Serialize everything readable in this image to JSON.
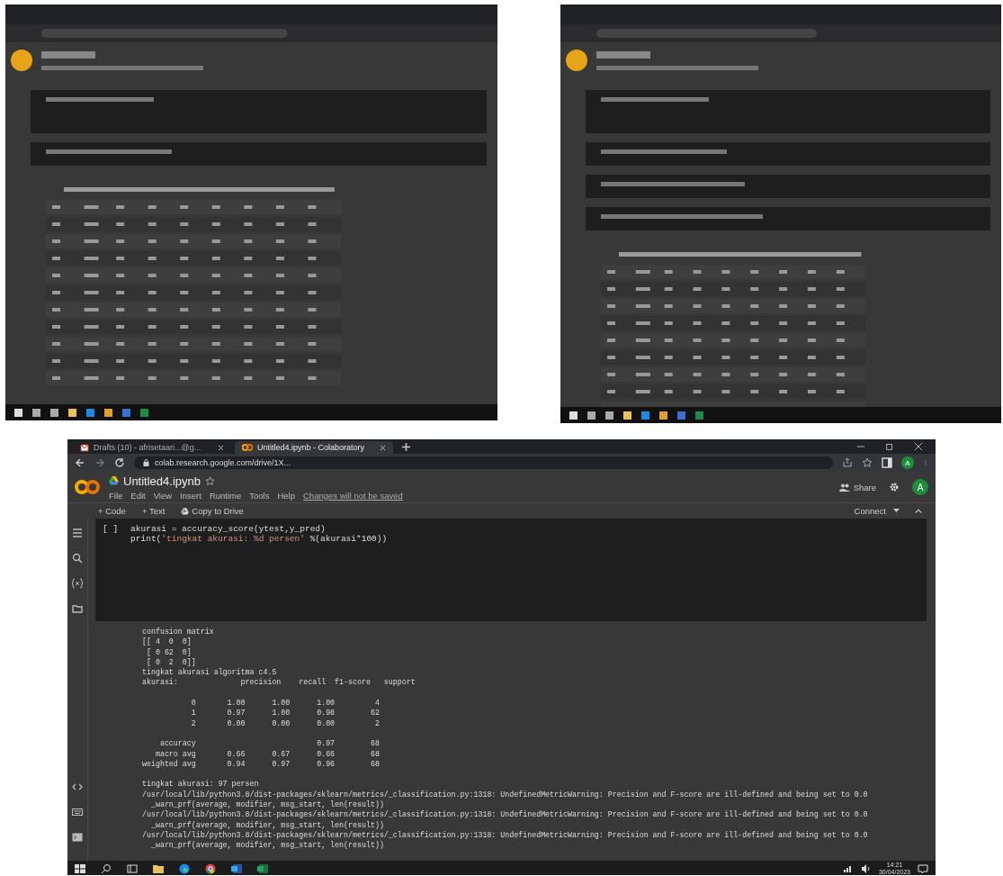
{
  "browser_tabs": [
    {
      "label": "Drafts (10) - afrisetaari...@g...",
      "kind": "mail",
      "selected": false
    },
    {
      "label": "Untitled4.ipynb - Colaboratory",
      "kind": "colab",
      "selected": true
    }
  ],
  "address_bar": {
    "url": "colab.research.google.com/drive/1X...",
    "avatar": "A"
  },
  "notebook": {
    "title": "Untitled4.ipynb",
    "menu": [
      "File",
      "Edit",
      "View",
      "Insert",
      "Runtime",
      "Tools",
      "Help"
    ],
    "notice": "Changes will not be saved",
    "share": "Share",
    "avatar": "A"
  },
  "toolbar": {
    "buttons": [
      "+ Code",
      "+ Text",
      "Copy to Drive"
    ],
    "connect": "Connect"
  },
  "code_cell": {
    "prompt": "[ ]",
    "lines": [
      [
        {
          "text": "akurasi = accuracy_score(ytest,y_pred)",
          "kind": "plain"
        }
      ],
      [
        {
          "text": "print(",
          "kind": "plain"
        },
        {
          "text": "'tingkat akurasi: %d persen'",
          "kind": "string"
        },
        {
          "text": " %(akurasi*100))",
          "kind": "plain"
        }
      ]
    ]
  },
  "output": {
    "blocks": [
      [
        "confusion matrix",
        "[[ 4  0  0]",
        " [ 0 62  0]",
        " [ 0  2  0]]",
        "tingkat akurasi algoritma c4.5",
        "akurasi:              precision    recall  f1-score   support"
      ],
      [
        "           0       1.00      1.00      1.00         4",
        "           1       0.97      1.00      0.98        62",
        "           2       0.00      0.00      0.00         2"
      ],
      [
        "    accuracy                           0.97        68",
        "   macro avg       0.66      0.67      0.66        68",
        "weighted avg       0.94      0.97      0.96        68"
      ],
      [
        "tingkat akurasi: 97 persen",
        "/usr/local/lib/python3.8/dist-packages/sklearn/metrics/_classification.py:1318: UndefinedMetricWarning: Precision and F-score are ill-defined and being set to 0.0",
        "  _warn_prf(average, modifier, msg_start, len(result))",
        "/usr/local/lib/python3.8/dist-packages/sklearn/metrics/_classification.py:1318: UndefinedMetricWarning: Precision and F-score are ill-defined and being set to 0.0",
        "  _warn_prf(average, modifier, msg_start, len(result))",
        "/usr/local/lib/python3.8/dist-packages/sklearn/metrics/_classification.py:1318: UndefinedMetricWarning: Precision and F-score are ill-defined and being set to 0.0",
        "  _warn_prf(average, modifier, msg_start, len(result))"
      ]
    ]
  },
  "taskbar": {
    "time": "14:21",
    "date": "30/04/2023"
  }
}
